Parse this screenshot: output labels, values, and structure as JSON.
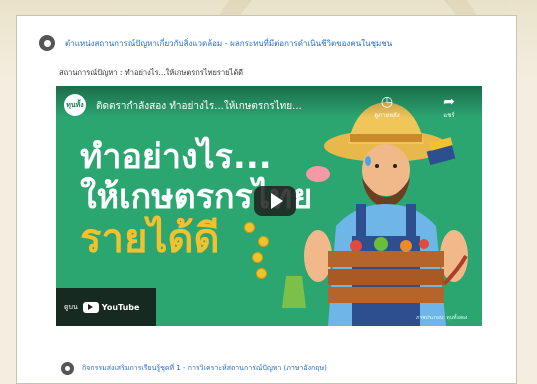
{
  "page": {
    "topic_link": "ตำแหน่งสถานการณ์ปัญหาเกี่ยวกับสิ่งแวดล้อม - ผลกระทบที่มีต่อการดำเนินชีวิตของคนในชุมชน",
    "subtitle": "สถานการณ์ปัญหา : ทำอย่างไร...ให้เกษตรกรไทยรายได้ดี",
    "next_link": "กิจกรรมส่งเสริมการเรียนรู้ชุดที่ 1 - การวิเคราะห์สถานการณ์ปัญหา (ภาษาอังกฤษ)"
  },
  "video": {
    "channel_logo": "ทุนทั้ง",
    "title": "ติดตรากำลังสอง ทำอย่างไร...ให้เกษตรกรไทย...",
    "watch_later_label": "ดูภายหลัง",
    "share_label": "แชร์",
    "headline_line1": "ทำอย่างไร...",
    "headline_line2": "ให้เกษตรกรไทย",
    "headline_line3": "รายได้ดี",
    "watch_on_label": "ดูบน",
    "youtube_label": "YouTube",
    "credit": "ภาพประกอบ: ทุนทั้งสอง"
  },
  "colors": {
    "video_bg": "#2ba671",
    "accent_yellow": "#f2c12e",
    "link_blue": "#2b6fc2"
  },
  "icons": {
    "topic": "circle-bullet-icon",
    "next": "circle-arrow-icon",
    "play": "play-icon",
    "watch_later": "clock-icon",
    "share": "share-icon"
  }
}
